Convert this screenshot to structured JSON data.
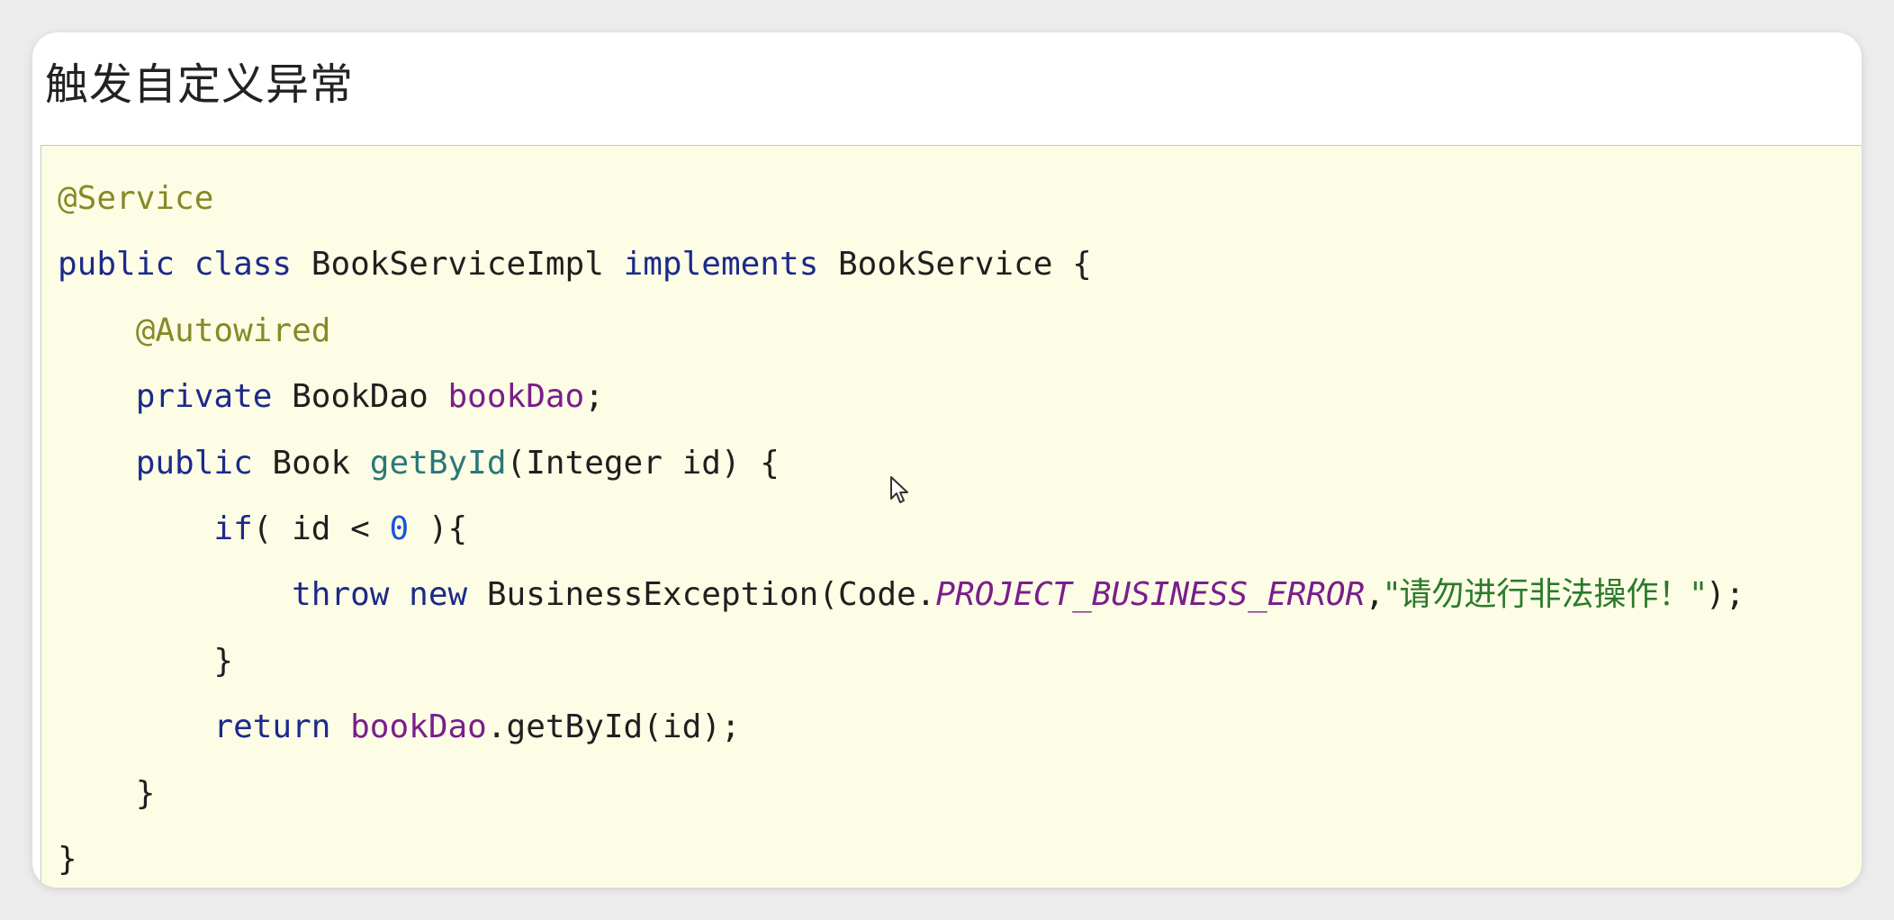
{
  "page": {
    "title": "触发自定义异常"
  },
  "code": {
    "lines": [
      {
        "indent": "",
        "tokens": [
          {
            "t": "@Service",
            "c": "ann"
          }
        ]
      },
      {
        "indent": "",
        "tokens": [
          {
            "t": "public",
            "c": "kw"
          },
          {
            "t": " ",
            "c": "plain"
          },
          {
            "t": "class",
            "c": "kw"
          },
          {
            "t": " BookServiceImpl ",
            "c": "plain"
          },
          {
            "t": "implements",
            "c": "kw"
          },
          {
            "t": " BookService {",
            "c": "plain"
          }
        ]
      },
      {
        "indent": "    ",
        "tokens": [
          {
            "t": "@Autowired",
            "c": "ann"
          }
        ]
      },
      {
        "indent": "    ",
        "tokens": [
          {
            "t": "private",
            "c": "kw"
          },
          {
            "t": " BookDao ",
            "c": "plain"
          },
          {
            "t": "bookDao",
            "c": "fld"
          },
          {
            "t": ";",
            "c": "plain"
          }
        ]
      },
      {
        "indent": "    ",
        "tokens": [
          {
            "t": "public",
            "c": "kw"
          },
          {
            "t": " Book ",
            "c": "plain"
          },
          {
            "t": "getById",
            "c": "mth"
          },
          {
            "t": "(Integer id) {",
            "c": "plain"
          }
        ]
      },
      {
        "indent": "        ",
        "tokens": [
          {
            "t": "if",
            "c": "kw"
          },
          {
            "t": "( id < ",
            "c": "plain"
          },
          {
            "t": "0",
            "c": "num"
          },
          {
            "t": " ){",
            "c": "plain"
          }
        ]
      },
      {
        "indent": "            ",
        "tokens": [
          {
            "t": "throw",
            "c": "kw"
          },
          {
            "t": " ",
            "c": "plain"
          },
          {
            "t": "new",
            "c": "kw"
          },
          {
            "t": " BusinessException(Code.",
            "c": "plain"
          },
          {
            "t": "PROJECT_BUSINESS_ERROR",
            "c": "cst"
          },
          {
            "t": ",",
            "c": "plain"
          },
          {
            "t": "\"请勿进行非法操作！\"",
            "c": "str"
          },
          {
            "t": ");",
            "c": "plain"
          }
        ]
      },
      {
        "indent": "        ",
        "tokens": [
          {
            "t": "}",
            "c": "plain"
          }
        ]
      },
      {
        "indent": "        ",
        "tokens": [
          {
            "t": "return",
            "c": "kw"
          },
          {
            "t": " ",
            "c": "plain"
          },
          {
            "t": "bookDao",
            "c": "fld"
          },
          {
            "t": ".getById(id);",
            "c": "plain"
          }
        ]
      },
      {
        "indent": "    ",
        "tokens": [
          {
            "t": "}",
            "c": "plain"
          }
        ]
      },
      {
        "indent": "",
        "tokens": [
          {
            "t": "}",
            "c": "plain"
          }
        ]
      }
    ]
  },
  "colors": {
    "code_background": "#fdfde6",
    "annotation": "#858a26",
    "keyword": "#1c2a8a",
    "field": "#7a1e8c",
    "method": "#2a7878",
    "number": "#1a55d8",
    "constant": "#7a1e8c",
    "string": "#2a7a2a"
  },
  "icons": {
    "cursor": "mouse-pointer-icon"
  }
}
